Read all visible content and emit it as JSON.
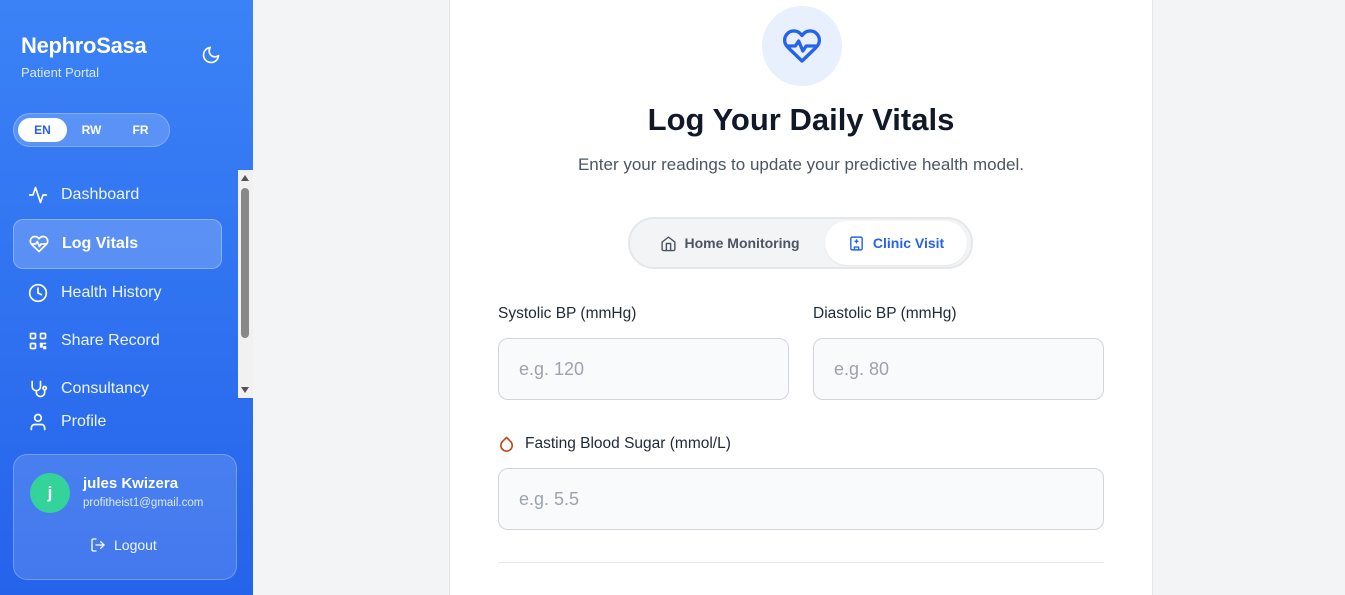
{
  "app": {
    "name": "NephroSasa",
    "subtitle": "Patient Portal",
    "theme_icon": "moon-icon"
  },
  "languages": [
    {
      "code": "EN",
      "active": true
    },
    {
      "code": "RW",
      "active": false
    },
    {
      "code": "FR",
      "active": false
    }
  ],
  "nav": {
    "items": [
      {
        "label": "Dashboard",
        "icon": "activity-icon",
        "active": false
      },
      {
        "label": "Log Vitals",
        "icon": "heart-pulse-icon",
        "active": true
      },
      {
        "label": "Health History",
        "icon": "clock-icon",
        "active": false
      },
      {
        "label": "Share Record",
        "icon": "qr-code-icon",
        "active": false
      },
      {
        "label": "Consultancy",
        "icon": "stethoscope-icon",
        "active": false
      },
      {
        "label": "Profile",
        "icon": "user-icon",
        "active": false
      }
    ]
  },
  "user": {
    "initial": "j",
    "name": "jules Kwizera",
    "email": "profitheist1@gmail.com",
    "logout_label": "Logout",
    "avatar_color": "#34d399"
  },
  "main": {
    "title": "Log Your Daily Vitals",
    "subtitle": "Enter your readings to update your predictive health model.",
    "modes": [
      {
        "label": "Home Monitoring",
        "icon": "home-icon",
        "active": false
      },
      {
        "label": "Clinic Visit",
        "icon": "hospital-icon",
        "active": true
      }
    ],
    "fields": {
      "systolic": {
        "label": "Systolic BP (mmHg)",
        "placeholder": "e.g. 120",
        "value": ""
      },
      "diastolic": {
        "label": "Diastolic BP (mmHg)",
        "placeholder": "e.g. 80",
        "value": ""
      },
      "sugar": {
        "label": "Fasting Blood Sugar (mmol/L)",
        "placeholder": "e.g. 5.5",
        "value": "",
        "icon": "droplet-icon"
      }
    }
  },
  "colors": {
    "primary": "#2563eb",
    "sidebar_top": "#3b82f6",
    "accent_orange": "#c2410c"
  }
}
